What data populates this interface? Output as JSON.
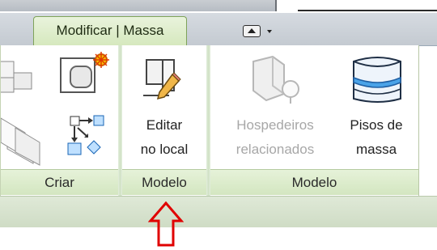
{
  "ribbon": {
    "active_tab": "Modificar | Massa",
    "qat_icon": "dropdown-arrow-icon",
    "panels": [
      {
        "title": "Criar"
      },
      {
        "title": "Modelo"
      },
      {
        "title": "Modelo"
      }
    ],
    "buttons": {
      "editar": {
        "line1": "Editar",
        "line2": "no local",
        "icon": "pencil-edit-icon"
      },
      "hospedeiros": {
        "line1": "Hospedeiros",
        "line2": "relacionados",
        "icon": "hosts-icon",
        "enabled": false
      },
      "pisos": {
        "line1": "Pisos de",
        "line2": "massa",
        "icon": "mass-floors-icon"
      }
    }
  },
  "annotation": {
    "color": "#e00000",
    "shape": "up-arrow"
  }
}
